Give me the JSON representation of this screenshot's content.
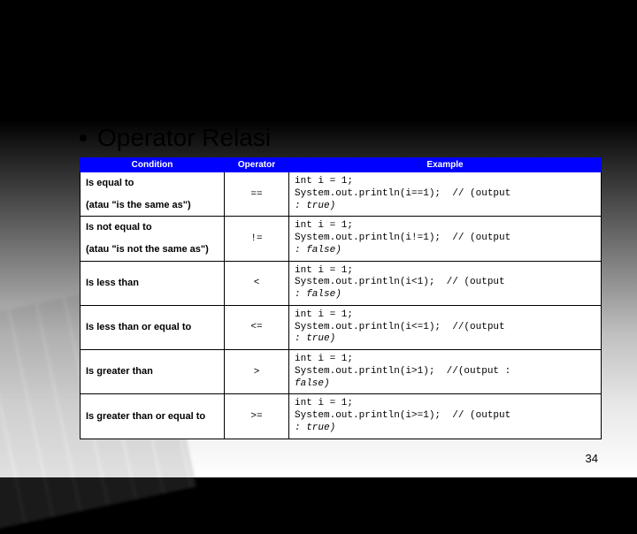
{
  "title": "Operator Relasi",
  "slide_number": "34",
  "headers": {
    "condition": "Condition",
    "operator": "Operator",
    "example": "Example"
  },
  "rows": [
    {
      "condition_line1": "Is equal to",
      "condition_line2": "(atau \"is the same as\")",
      "operator": "==",
      "ex_line1": "int i = 1;",
      "ex_line2": "System.out.println(i==1);  // (output",
      "ex_line3": ": true)"
    },
    {
      "condition_line1": "Is not equal to",
      "condition_line2": "(atau \"is not the same as\")",
      "operator": "!=",
      "ex_line1": "int i = 1;",
      "ex_line2": "System.out.println(i!=1);  // (output",
      "ex_line3": ": false)"
    },
    {
      "condition_line1": "Is less than",
      "condition_line2": "",
      "operator": "<",
      "ex_line1": "int i = 1;",
      "ex_line2": "System.out.println(i<1);  // (output",
      "ex_line3": ": false)"
    },
    {
      "condition_line1": "Is less than or equal to",
      "condition_line2": "",
      "operator": "<=",
      "ex_line1": "int i = 1;",
      "ex_line2": "System.out.println(i<=1);  //(output",
      "ex_line3": ": true)"
    },
    {
      "condition_line1": "Is greater than",
      "condition_line2": "",
      "operator": ">",
      "ex_line1": "int i = 1;",
      "ex_line2": "System.out.println(i>1);  //(output :",
      "ex_line3": "false)"
    },
    {
      "condition_line1": "Is greater than or equal to",
      "condition_line2": "",
      "operator": ">=",
      "ex_line1": "int i = 1;",
      "ex_line2": "System.out.println(i>=1);  // (output",
      "ex_line3": ": true)"
    }
  ]
}
